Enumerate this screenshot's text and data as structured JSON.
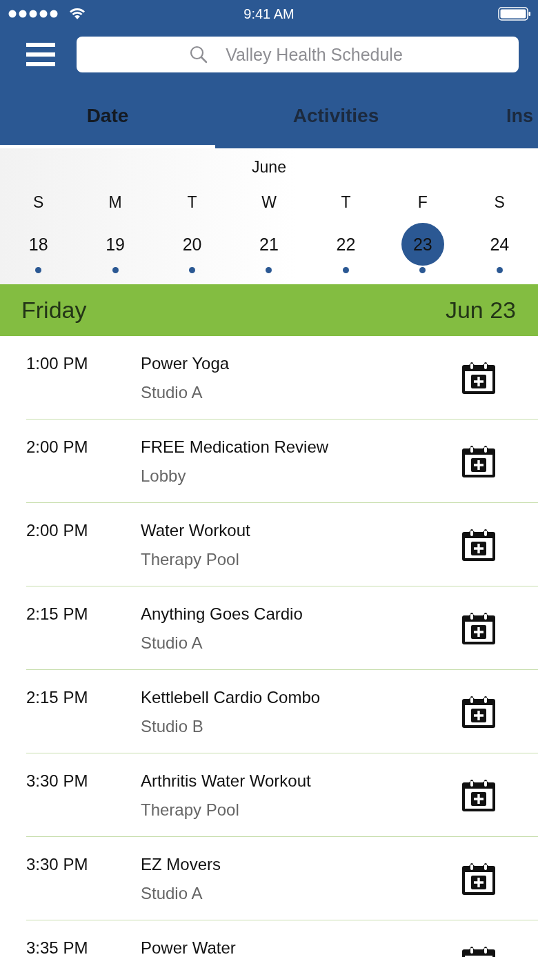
{
  "status_bar": {
    "time": "9:41 AM"
  },
  "search": {
    "placeholder": "Valley Health Schedule"
  },
  "tabs": [
    {
      "label": "Date",
      "selected": true
    },
    {
      "label": "Activities",
      "selected": false
    },
    {
      "label": "Ins",
      "selected": false
    }
  ],
  "calendar": {
    "month": "June",
    "days": [
      {
        "weekday": "S",
        "date": "18",
        "selected": false,
        "has_events": true
      },
      {
        "weekday": "M",
        "date": "19",
        "selected": false,
        "has_events": true
      },
      {
        "weekday": "T",
        "date": "20",
        "selected": false,
        "has_events": true
      },
      {
        "weekday": "W",
        "date": "21",
        "selected": false,
        "has_events": true
      },
      {
        "weekday": "T",
        "date": "22",
        "selected": false,
        "has_events": true
      },
      {
        "weekday": "F",
        "date": "23",
        "selected": true,
        "has_events": true
      },
      {
        "weekday": "S",
        "date": "24",
        "selected": false,
        "has_events": true
      }
    ]
  },
  "day_header": {
    "weekday": "Friday",
    "date": "Jun 23"
  },
  "events": [
    {
      "time": "1:00 PM",
      "title": "Power Yoga",
      "location": "Studio A"
    },
    {
      "time": "2:00 PM",
      "title": "FREE Medication Review",
      "location": "Lobby"
    },
    {
      "time": "2:00 PM",
      "title": "Water Workout",
      "location": "Therapy Pool"
    },
    {
      "time": "2:15 PM",
      "title": "Anything Goes Cardio",
      "location": "Studio A"
    },
    {
      "time": "2:15 PM",
      "title": "Kettlebell Cardio Combo",
      "location": "Studio B"
    },
    {
      "time": "3:30 PM",
      "title": "Arthritis Water Workout",
      "location": "Therapy Pool"
    },
    {
      "time": "3:30 PM",
      "title": "EZ Movers",
      "location": "Studio A"
    },
    {
      "time": "3:35 PM",
      "title": "Power Water"
    }
  ]
}
